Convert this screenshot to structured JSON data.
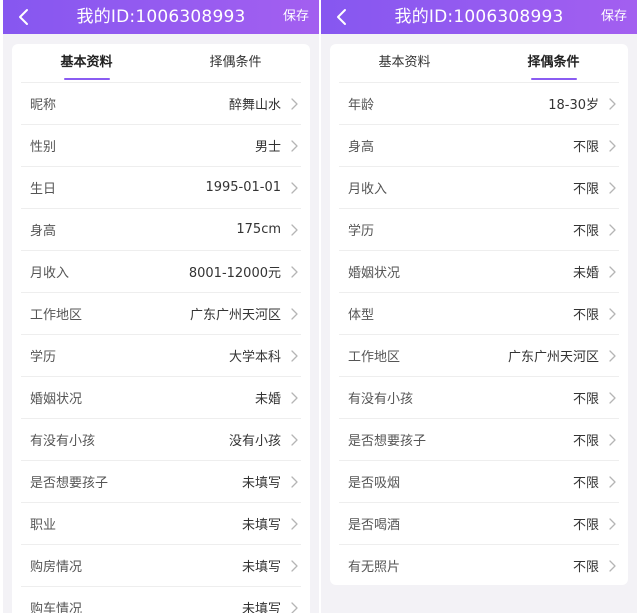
{
  "left": {
    "header": {
      "title": "我的ID:1006308993",
      "save_label": "保存"
    },
    "tabs": [
      {
        "label": "基本资料"
      },
      {
        "label": "择偶条件"
      }
    ],
    "rows": [
      {
        "label": "昵称",
        "value": "醉舞山水"
      },
      {
        "label": "性别",
        "value": "男士"
      },
      {
        "label": "生日",
        "value": "1995-01-01"
      },
      {
        "label": "身高",
        "value": "175cm"
      },
      {
        "label": "月收入",
        "value": "8001-12000元"
      },
      {
        "label": "工作地区",
        "value": "广东广州天河区"
      },
      {
        "label": "学历",
        "value": "大学本科"
      },
      {
        "label": "婚姻状况",
        "value": "未婚"
      },
      {
        "label": "有没有小孩",
        "value": "没有小孩"
      },
      {
        "label": "是否想要孩子",
        "value": "未填写"
      },
      {
        "label": "职业",
        "value": "未填写"
      },
      {
        "label": "购房情况",
        "value": "未填写"
      },
      {
        "label": "购车情况",
        "value": "未填写"
      }
    ]
  },
  "right": {
    "header": {
      "title": "我的ID:1006308993",
      "save_label": "保存"
    },
    "tabs": [
      {
        "label": "基本资料"
      },
      {
        "label": "择偶条件"
      }
    ],
    "rows": [
      {
        "label": "年龄",
        "value": "18-30岁"
      },
      {
        "label": "身高",
        "value": "不限"
      },
      {
        "label": "月收入",
        "value": "不限"
      },
      {
        "label": "学历",
        "value": "不限"
      },
      {
        "label": "婚姻状况",
        "value": "未婚"
      },
      {
        "label": "体型",
        "value": "不限"
      },
      {
        "label": "工作地区",
        "value": "广东广州天河区"
      },
      {
        "label": "有没有小孩",
        "value": "不限"
      },
      {
        "label": "是否想要孩子",
        "value": "不限"
      },
      {
        "label": "是否吸烟",
        "value": "不限"
      },
      {
        "label": "是否喝酒",
        "value": "不限"
      },
      {
        "label": "有无照片",
        "value": "不限"
      }
    ]
  },
  "colors": {
    "accent": "#8a5cf2",
    "header_start": "#8657f0",
    "header_end": "#a35ff0"
  },
  "icons": {
    "back": "chevron-left-icon",
    "row": "chevron-right-icon"
  }
}
